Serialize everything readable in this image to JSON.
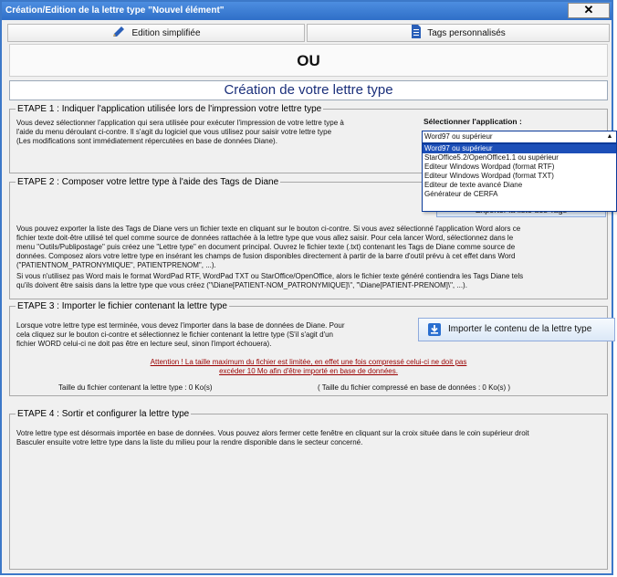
{
  "window": {
    "title": "Création/Edition de la lettre type \"Nouvel élément\"",
    "close_symbol": "✕"
  },
  "toolbar": {
    "simple_edit_label": "Edition simplifiée",
    "custom_tags_label": "Tags personnalisés"
  },
  "ou_label": "OU",
  "creation_title": "Création de votre lettre type",
  "step1": {
    "legend": "ETAPE 1 : Indiquer l'application utilisée lors de l'impression votre lettre type",
    "line1": "Vous devez sélectionner l'application qui sera utilisée pour exécuter l'impression de votre lettre type à",
    "line2": "l'aide du menu déroulant ci-contre. Il s'agit du logiciel que vous utilisez pour saisir votre lettre type",
    "line3": "(Les modifications sont immédiatement répercutées en base de données Diane).",
    "app_label": "Sélectionner l'application :",
    "selected": "Word97 ou supérieur",
    "options": [
      "Word97 ou supérieur",
      "StarOffice5.2/OpenOffice1.1 ou supérieur",
      "Editeur Windows Wordpad (format RTF)",
      "Editeur Windows Wordpad (format TXT)",
      "Editeur de texte avancé Diane",
      "Générateur de CERFA"
    ]
  },
  "step2": {
    "legend": "ETAPE 2 : Composer votre lettre type à l'aide des Tags de Diane",
    "export_button": "Exporter la liste des  Tags",
    "line1": "Vous pouvez exporter la liste des Tags de Diane vers un fichier texte en cliquant sur le bouton ci-contre. Si vous avez sélectionné l'application Word alors ce",
    "line2": "fichier texte doit-être utilisé tel quel comme source de données rattachée à la lettre type que vous allez saisir. Pour cela lancer Word, sélectionnez dans le",
    "line3": "menu \"Outils/Publipostage\" puis créez une \"Lettre type\" en document principal. Ouvrez le fichier texte (.txt) contenant les Tags de Diane comme source de",
    "line4": "données. Composez alors votre lettre type en insérant les champs de fusion disponibles directement à partir de la barre d'outil prévu à cet effet dans Word",
    "line5": "(\"PATIENTNOM_PATRONYMIQUE\", PATIENTPRENOM\", ...).",
    "line6": "Si vous n'utilisez pas Word mais le format WordPad RTF, WordPad TXT ou StarOffice/OpenOffice, alors le fichier texte généré contiendra les Tags Diane tels",
    "line7": "qu'ils doivent être saisis dans la lettre type que vous créez (\"\\Diane[PATIENT-NOM_PATRONYMIQUE]\\\", \"\\Diane[PATIENT-PRENOM]\\\", ...)."
  },
  "step3": {
    "legend": "ETAPE 3 : Importer le fichier contenant la lettre type",
    "line1": "Lorsque votre lettre type est terminée, vous devez l'importer dans la base de données de Diane. Pour",
    "line2": "cela cliquez sur le bouton ci-contre et sélectionnez le fichier contenant la lettre type (S'il s'agit d'un",
    "line3": "fichier WORD celui-ci ne doit pas être en lecture seul, sinon l'import échouera).",
    "import_button": "Importer le contenu de la lettre type",
    "warning1": "Attention ! La taille maximum du fichier est limitée, en effet une fois compressé celui-ci ne doit pas",
    "warning2": "excéder 10 Mo afin d'être importé en base de données.",
    "size_label": "Taille du fichier contenant la lettre type : 0 Ko(s)",
    "compressed_label": "( Taille du fichier compressé en base de données : 0 Ko(s) )"
  },
  "step4": {
    "legend": "ETAPE 4 : Sortir et configurer la lettre type",
    "line1": "Votre lettre type est désormais importée en base de données. Vous pouvez alors fermer cette fenêtre en cliquant sur la croix située dans le coin supérieur droit",
    "line2": "Basculer ensuite votre lettre type dans la liste du milieu pour la rendre disponible dans le secteur concerné."
  },
  "colors": {
    "titlebar": "#2f6fc8",
    "title_text": "#1a2f7a",
    "warning": "#9b0000",
    "selection": "#1c4fb8"
  }
}
